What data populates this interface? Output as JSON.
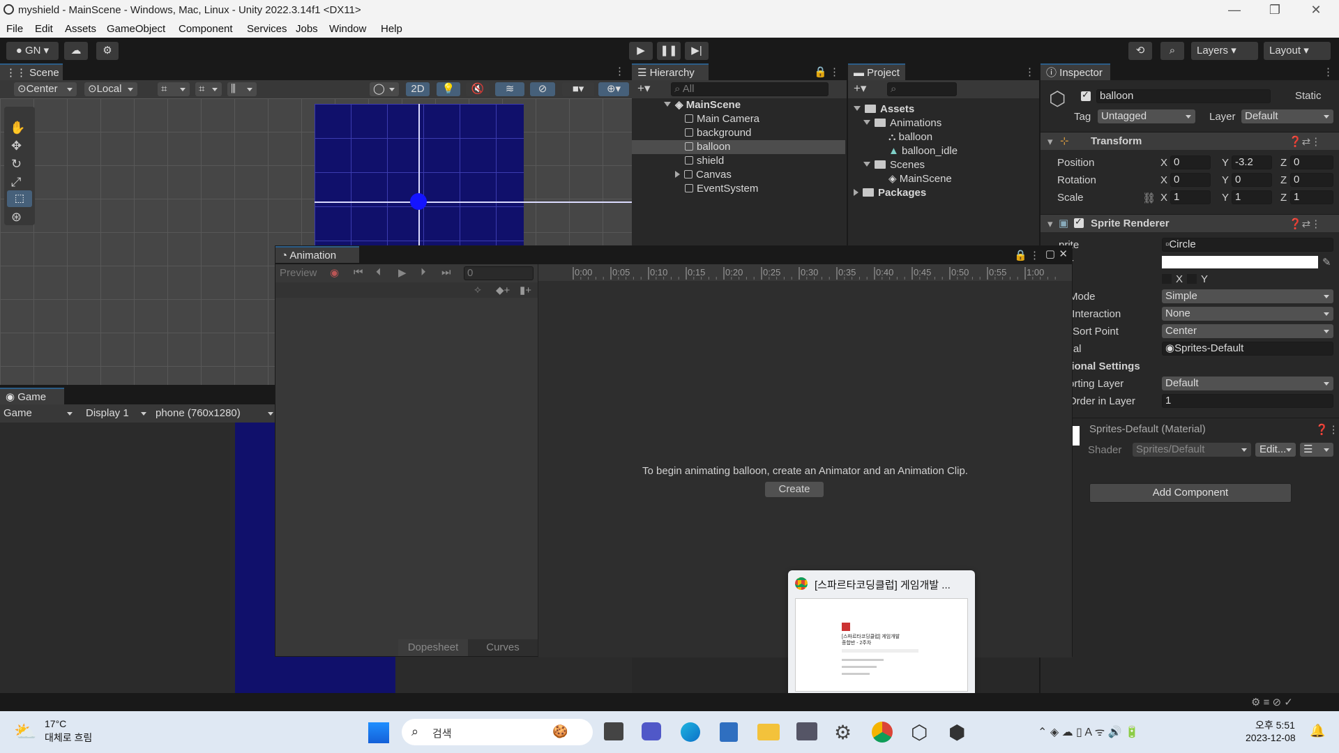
{
  "window": {
    "title": "myshield - MainScene - Windows, Mac, Linux - Unity 2022.3.14f1 <DX11>"
  },
  "menu": [
    "File",
    "Edit",
    "Assets",
    "GameObject",
    "Component",
    "Services",
    "Jobs",
    "Window",
    "Help"
  ],
  "toolbar": {
    "account": "GN",
    "layers": "Layers",
    "layout": "Layout"
  },
  "scene": {
    "tab": "Scene",
    "pivot": "Center",
    "space": "Local",
    "mode2d": "2D"
  },
  "game": {
    "tab": "Game",
    "view": "Game",
    "display": "Display 1",
    "resolution": "phone (760x1280)"
  },
  "hierarchy": {
    "tab": "Hierarchy",
    "search": "All",
    "root": "MainScene",
    "items": [
      "Main Camera",
      "background",
      "balloon",
      "shield",
      "Canvas",
      "EventSystem"
    ]
  },
  "project": {
    "tab": "Project",
    "assets": "Assets",
    "animations": "Animations",
    "anim_items": [
      "balloon",
      "balloon_idle"
    ],
    "scenes": "Scenes",
    "scene_items": [
      "MainScene"
    ],
    "packages": "Packages"
  },
  "animation": {
    "tab": "Animation",
    "preview": "Preview",
    "frame": "0",
    "ticks": [
      "0:00",
      "0:05",
      "0:10",
      "0:15",
      "0:20",
      "0:25",
      "0:30",
      "0:35",
      "0:40",
      "0:45",
      "0:50",
      "0:55",
      "1:00"
    ],
    "message": "To begin animating balloon, create an Animator and an Animation Clip.",
    "create": "Create",
    "dopesheet": "Dopesheet",
    "curves": "Curves"
  },
  "inspector": {
    "tab": "Inspector",
    "name": "balloon",
    "static": "Static",
    "tag_label": "Tag",
    "tag": "Untagged",
    "layer_label": "Layer",
    "layer": "Default",
    "transform": {
      "title": "Transform",
      "position": {
        "label": "Position",
        "x": "0",
        "y": "-3.2",
        "z": "0"
      },
      "rotation": {
        "label": "Rotation",
        "x": "0",
        "y": "0",
        "z": "0"
      },
      "scale": {
        "label": "Scale",
        "x": "1",
        "y": "1",
        "z": "1"
      }
    },
    "sprite_renderer": {
      "title": "Sprite Renderer",
      "sprite_label": "prite",
      "sprite": "Circle",
      "color_label": "or",
      "flip_label": "",
      "flip_x": "X",
      "flip_y": "Y",
      "draw_mode_label": "w Mode",
      "draw_mode": "Simple",
      "mask_label": "sk Interaction",
      "mask": "None",
      "sort_point_label": "ite Sort Point",
      "sort_point": "Center",
      "material_label": "terial",
      "material": "Sprites-Default",
      "additional": "ditional Settings",
      "sorting_layer_label": "orting Layer",
      "sorting_layer": "Default",
      "order_label": "Order in Layer",
      "order": "1"
    },
    "material": {
      "title": "Sprites-Default (Material)",
      "shader_label": "Shader",
      "shader": "Sprites/Default",
      "edit": "Edit..."
    },
    "add_component": "Add Component"
  },
  "popup": {
    "title": "[스파르타코딩클럽] 게임개발 ...",
    "thumb_text": "[스파르타코딩클럽] 게임개발 종합반 - 2주차"
  },
  "taskbar": {
    "temp": "17°C",
    "weather": "대체로 흐림",
    "search": "검색",
    "time": "오후 5:51",
    "date": "2023-12-08"
  },
  "colors": {
    "scene_bg": "#10106b",
    "accent": "#2c5d87"
  }
}
